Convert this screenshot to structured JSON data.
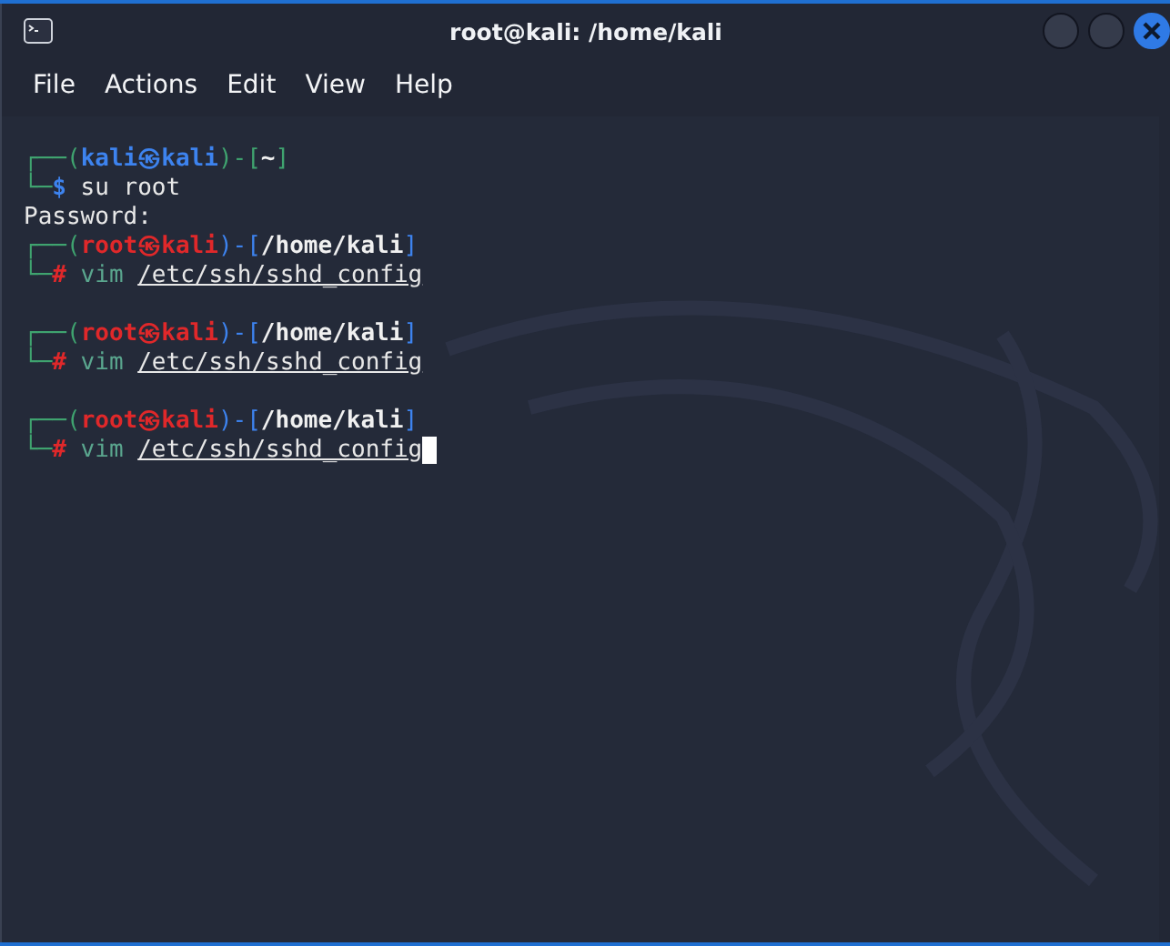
{
  "window": {
    "title": "root@kali: /home/kali"
  },
  "menu": [
    "File",
    "Actions",
    "Edit",
    "View",
    "Help"
  ],
  "terminal": {
    "lines": [
      {
        "kind": "prompt",
        "corner": "┌──(",
        "user": "kali",
        "at": "㉿",
        "host": "kali",
        "mid": ")-[",
        "path": "~",
        "end": "]",
        "root": false
      },
      {
        "kind": "command",
        "corner": "└─",
        "sign": "$",
        "command": "su root",
        "root": false,
        "cursor": false
      },
      {
        "kind": "output",
        "text": "Password:"
      },
      {
        "kind": "prompt",
        "corner": "┌──(",
        "user": "root",
        "at": "㉿",
        "host": "kali",
        "mid": ")-[",
        "path": "/home/kali",
        "end": "]",
        "root": true
      },
      {
        "kind": "command",
        "corner": "└─",
        "sign": "#",
        "command": "vim",
        "argument": "/etc/ssh/sshd_config",
        "root": true,
        "cursor": false
      },
      {
        "kind": "blank"
      },
      {
        "kind": "prompt",
        "corner": "┌──(",
        "user": "root",
        "at": "㉿",
        "host": "kali",
        "mid": ")-[",
        "path": "/home/kali",
        "end": "]",
        "root": true
      },
      {
        "kind": "command",
        "corner": "└─",
        "sign": "#",
        "command": "vim",
        "argument": "/etc/ssh/sshd_config",
        "root": true,
        "cursor": false
      },
      {
        "kind": "blank"
      },
      {
        "kind": "prompt",
        "corner": "┌──(",
        "user": "root",
        "at": "㉿",
        "host": "kali",
        "mid": ")-[",
        "path": "/home/kali",
        "end": "]",
        "root": true
      },
      {
        "kind": "command",
        "corner": "└─",
        "sign": "#",
        "command": "vim",
        "argument": "/etc/ssh/sshd_config",
        "root": true,
        "cursor": true
      }
    ]
  }
}
